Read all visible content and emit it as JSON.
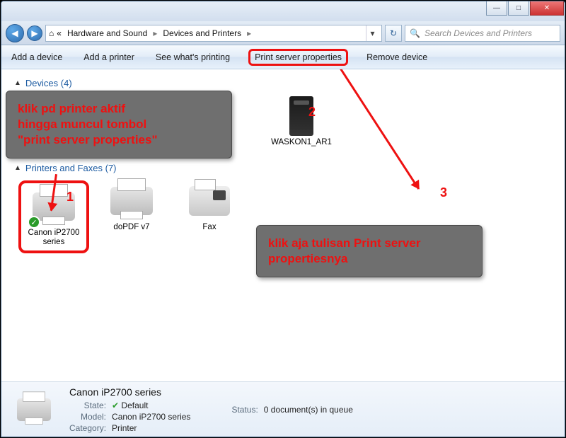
{
  "titlebar": {
    "minimize": "—",
    "maximize": "□",
    "close": "✕"
  },
  "addressbar": {
    "back": "◀",
    "forward": "▶",
    "crumbs": [
      "Hardware and Sound",
      "Devices and Printers"
    ],
    "sep": "▸",
    "dropdown": "▾",
    "refresh": "↻"
  },
  "search": {
    "icon": "🔍",
    "placeholder": "Search Devices and Printers"
  },
  "toolbar": {
    "add_device": "Add a device",
    "add_printer": "Add a printer",
    "see_printing": "See what's printing",
    "print_server_props": "Print server properties",
    "remove_device": "Remove device"
  },
  "groups": {
    "devices": {
      "label": "Devices (4)",
      "triangle": "▲"
    },
    "printers": {
      "label": "Printers and Faxes (7)",
      "triangle": "▲"
    }
  },
  "devices": {
    "item1": {
      "label": "WASKON1_AR1"
    }
  },
  "printers": {
    "item0": {
      "label": "Canon iP2700 series"
    },
    "item1": {
      "label": "doPDF v7"
    },
    "item2": {
      "label": "Fax"
    }
  },
  "annotation": {
    "box1": "klik pd printer aktif\nhingga muncul tombol\n\"print server properties\"",
    "box2": "klik aja tulisan Print server\npropertiesnya",
    "n1": "1",
    "n2": "2",
    "n3": "3"
  },
  "details": {
    "title": "Canon iP2700 series",
    "state_k": "State:",
    "state_v": "Default",
    "model_k": "Model:",
    "model_v": "Canon iP2700 series",
    "category_k": "Category:",
    "category_v": "Printer",
    "status_k": "Status:",
    "status_v": "0 document(s) in queue"
  }
}
